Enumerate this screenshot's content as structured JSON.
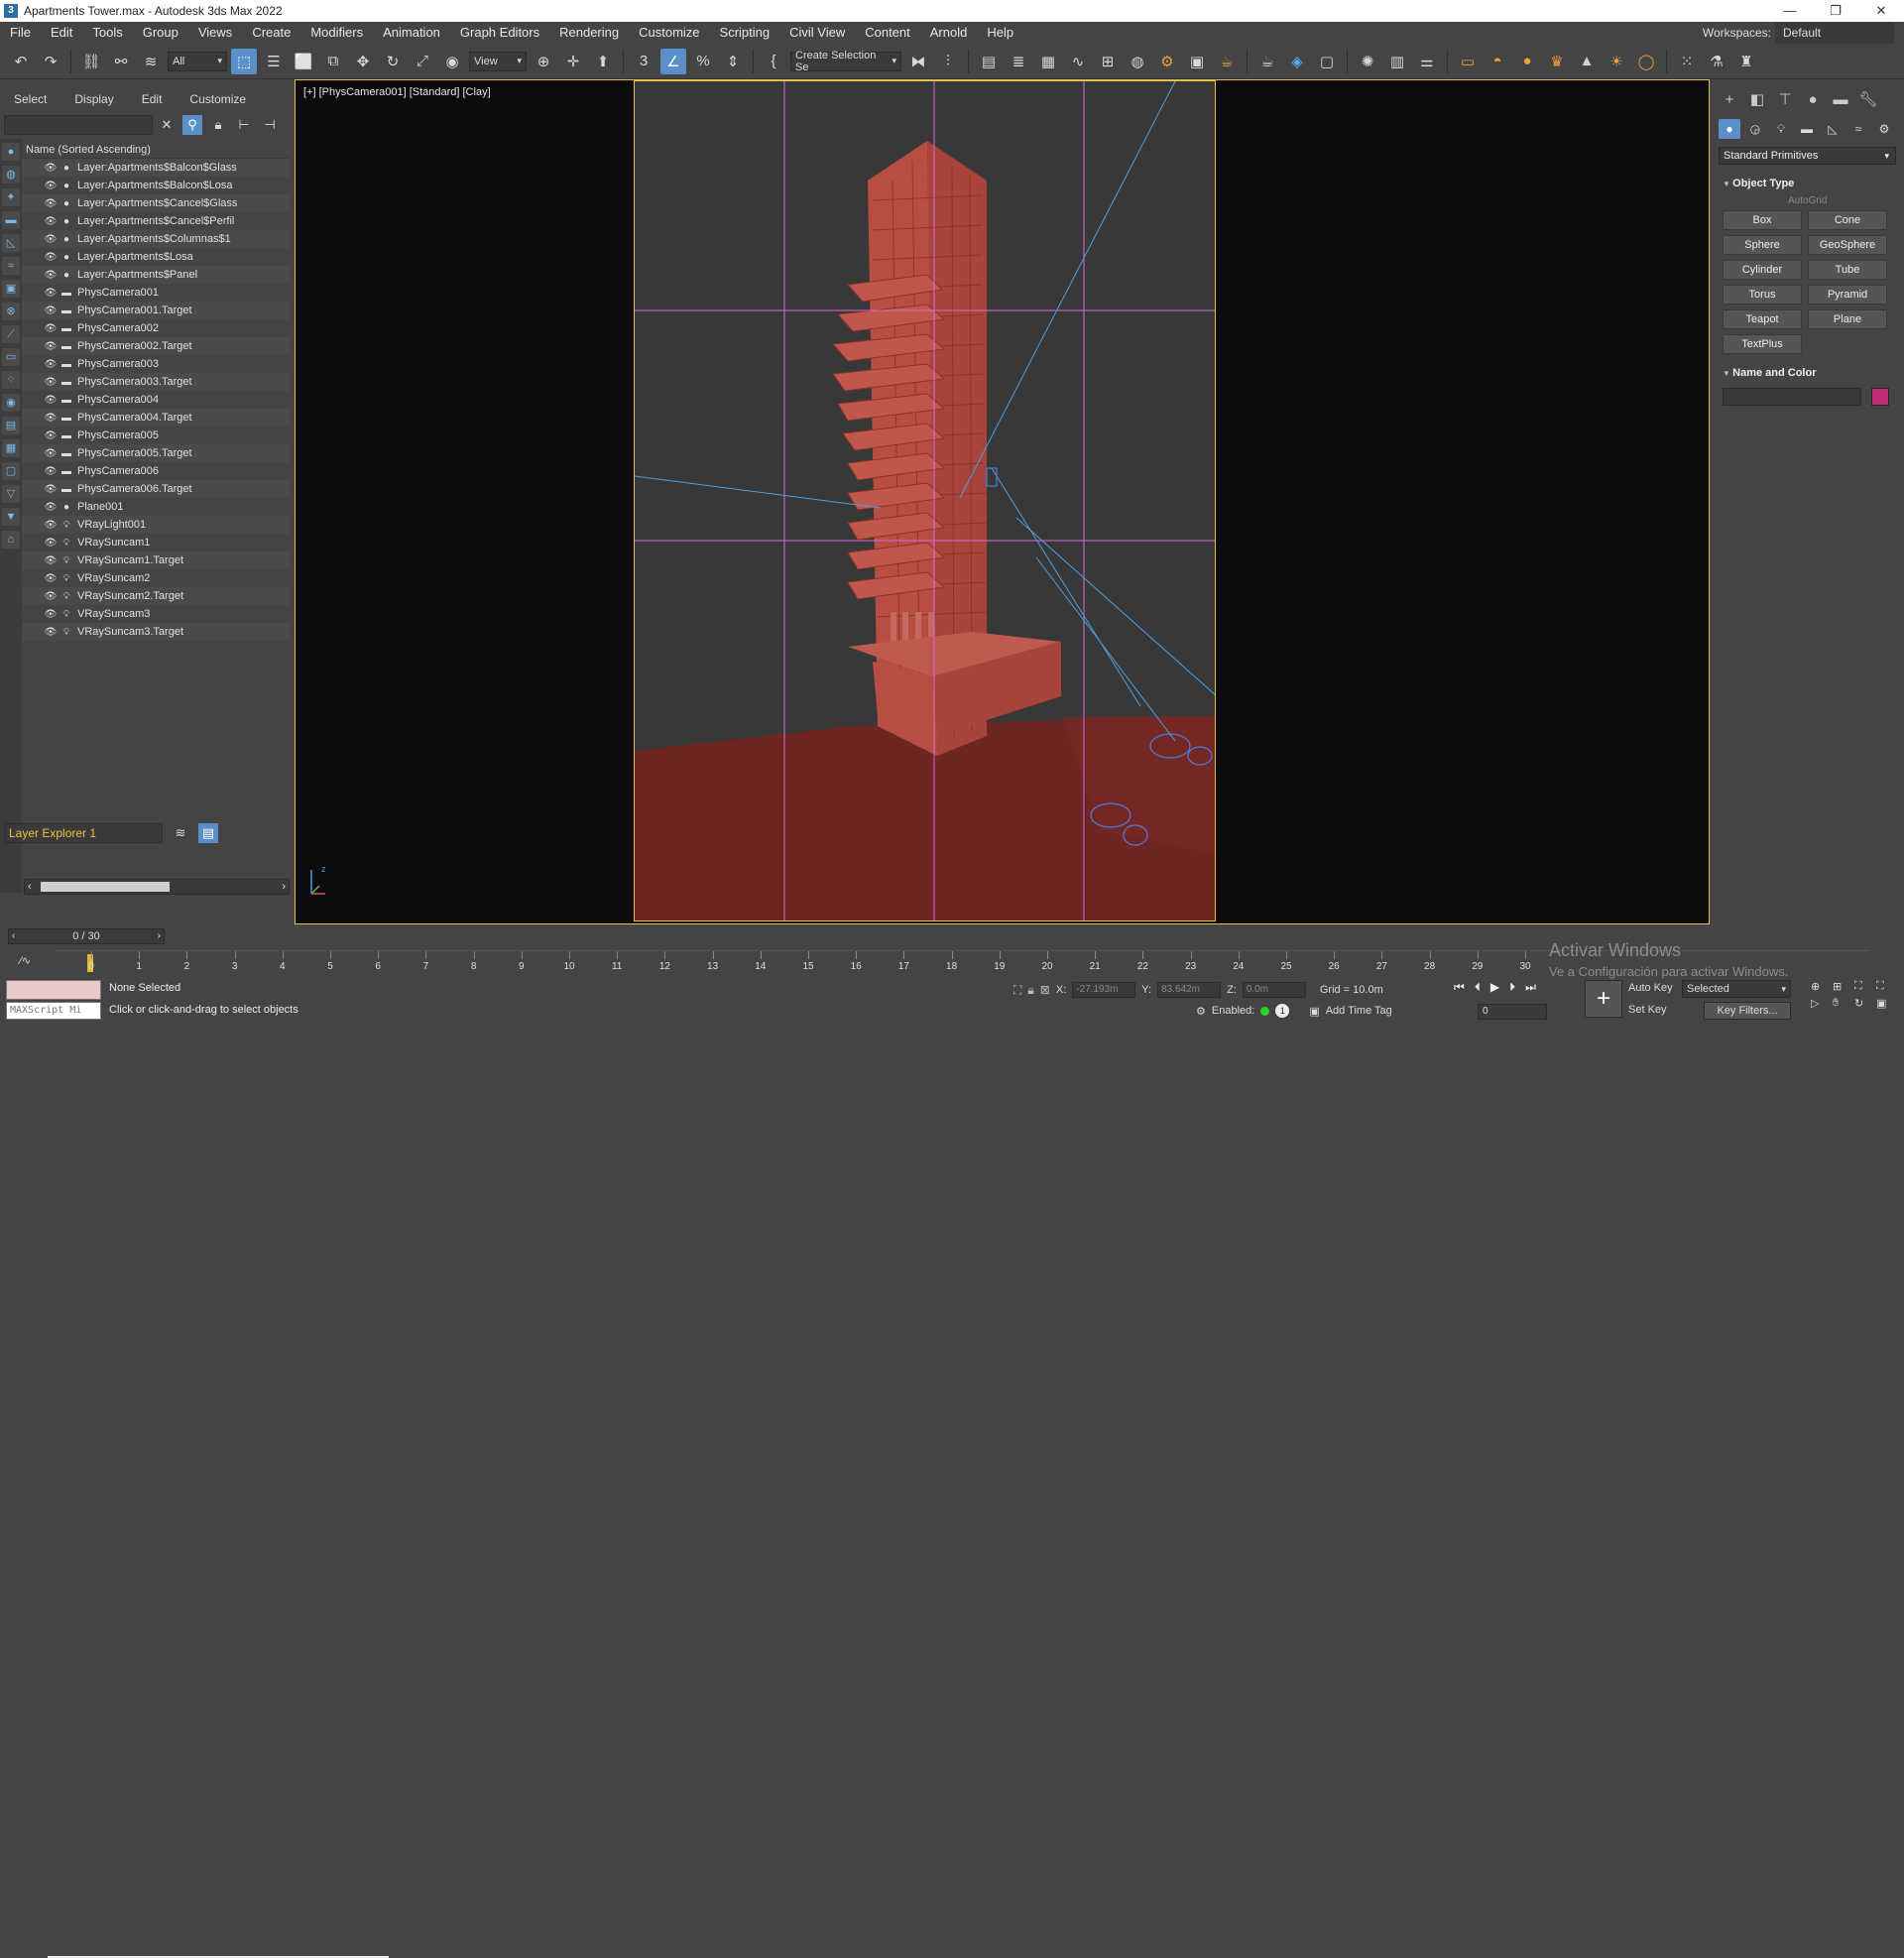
{
  "window": {
    "title": "Apartments Tower.max - Autodesk 3ds Max 2022",
    "app_icon": "3",
    "controls": [
      "—",
      "❐",
      "✕"
    ]
  },
  "menu": {
    "items": [
      "File",
      "Edit",
      "Tools",
      "Group",
      "Views",
      "Create",
      "Modifiers",
      "Animation",
      "Graph Editors",
      "Rendering",
      "Customize",
      "Scripting",
      "Civil View",
      "Content",
      "Arnold",
      "Help"
    ],
    "workspaces_label": "Workspaces:",
    "workspace_value": "Default"
  },
  "toolbar": {
    "filter_value": "All",
    "refcoord_value": "View",
    "selection_set_value": "Create Selection Se"
  },
  "explorer": {
    "tabs": [
      "Select",
      "Display",
      "Edit",
      "Customize"
    ],
    "header": "Name (Sorted Ascending)",
    "rows": [
      {
        "name": "Layer:Apartments$Balcon$Glass",
        "icon": "layer"
      },
      {
        "name": "Layer:Apartments$Balcon$Losa",
        "icon": "layer"
      },
      {
        "name": "Layer:Apartments$Cancel$Glass",
        "icon": "layer"
      },
      {
        "name": "Layer:Apartments$Cancel$Perfil",
        "icon": "layer"
      },
      {
        "name": "Layer:Apartments$Columnas$1",
        "icon": "layer"
      },
      {
        "name": "Layer:Apartments$Losa",
        "icon": "layer"
      },
      {
        "name": "Layer:Apartments$Panel",
        "icon": "layer"
      },
      {
        "name": "PhysCamera001",
        "icon": "camera"
      },
      {
        "name": "PhysCamera001.Target",
        "icon": "camera"
      },
      {
        "name": "PhysCamera002",
        "icon": "camera"
      },
      {
        "name": "PhysCamera002.Target",
        "icon": "camera"
      },
      {
        "name": "PhysCamera003",
        "icon": "camera"
      },
      {
        "name": "PhysCamera003.Target",
        "icon": "camera"
      },
      {
        "name": "PhysCamera004",
        "icon": "camera"
      },
      {
        "name": "PhysCamera004.Target",
        "icon": "camera"
      },
      {
        "name": "PhysCamera005",
        "icon": "camera"
      },
      {
        "name": "PhysCamera005.Target",
        "icon": "camera"
      },
      {
        "name": "PhysCamera006",
        "icon": "camera"
      },
      {
        "name": "PhysCamera006.Target",
        "icon": "camera"
      },
      {
        "name": "Plane001",
        "icon": "geometry"
      },
      {
        "name": "VRayLight001",
        "icon": "light"
      },
      {
        "name": "VRaySuncam1",
        "icon": "light"
      },
      {
        "name": "VRaySuncam1.Target",
        "icon": "light"
      },
      {
        "name": "VRaySuncam2",
        "icon": "light"
      },
      {
        "name": "VRaySuncam2.Target",
        "icon": "light"
      },
      {
        "name": "VRaySuncam3",
        "icon": "light"
      },
      {
        "name": "VRaySuncam3.Target",
        "icon": "light"
      }
    ],
    "layer_explorer": "Layer Explorer 1"
  },
  "viewport": {
    "label": "[+] [PhysCamera001] [Standard] [Clay]",
    "axis_label": "z",
    "building_color": "#b0483c",
    "ground_color": "#7a2a25"
  },
  "command_panel": {
    "category": "Standard Primitives",
    "object_type_title": "Object Type",
    "autogrid": "AutoGrid",
    "buttons": [
      "Box",
      "Cone",
      "Sphere",
      "GeoSphere",
      "Cylinder",
      "Tube",
      "Torus",
      "Pyramid",
      "Teapot",
      "Plane",
      "TextPlus"
    ],
    "name_color_title": "Name and Color",
    "object_color": "#c0307a"
  },
  "timeline": {
    "frame_display": "0 / 30",
    "ticks": [
      "0",
      "1",
      "2",
      "3",
      "4",
      "5",
      "6",
      "7",
      "8",
      "9",
      "10",
      "11",
      "12",
      "13",
      "14",
      "15",
      "16",
      "17",
      "18",
      "19",
      "20",
      "21",
      "22",
      "23",
      "24",
      "25",
      "26",
      "27",
      "28",
      "29",
      "30"
    ]
  },
  "status": {
    "script_placeholder": "MAXScript Mi",
    "selection": "None Selected",
    "prompt": "Click or click-and-drag to select objects",
    "x_label": "X:",
    "x_value": "-27.193m",
    "y_label": "Y:",
    "y_value": "83.642m",
    "z_label": "Z:",
    "z_value": "0.0m",
    "grid": "Grid = 10.0m",
    "enabled": "Enabled:",
    "enabled_num": "1",
    "add_time_tag": "Add Time Tag",
    "auto_key": "Auto Key",
    "set_key": "Set Key",
    "selected_value": "Selected",
    "key_filters": "Key Filters...",
    "current_frame": "0"
  },
  "watermark": {
    "line1": "Activar Windows",
    "line2": "Ve a Configuración para activar Windows."
  }
}
